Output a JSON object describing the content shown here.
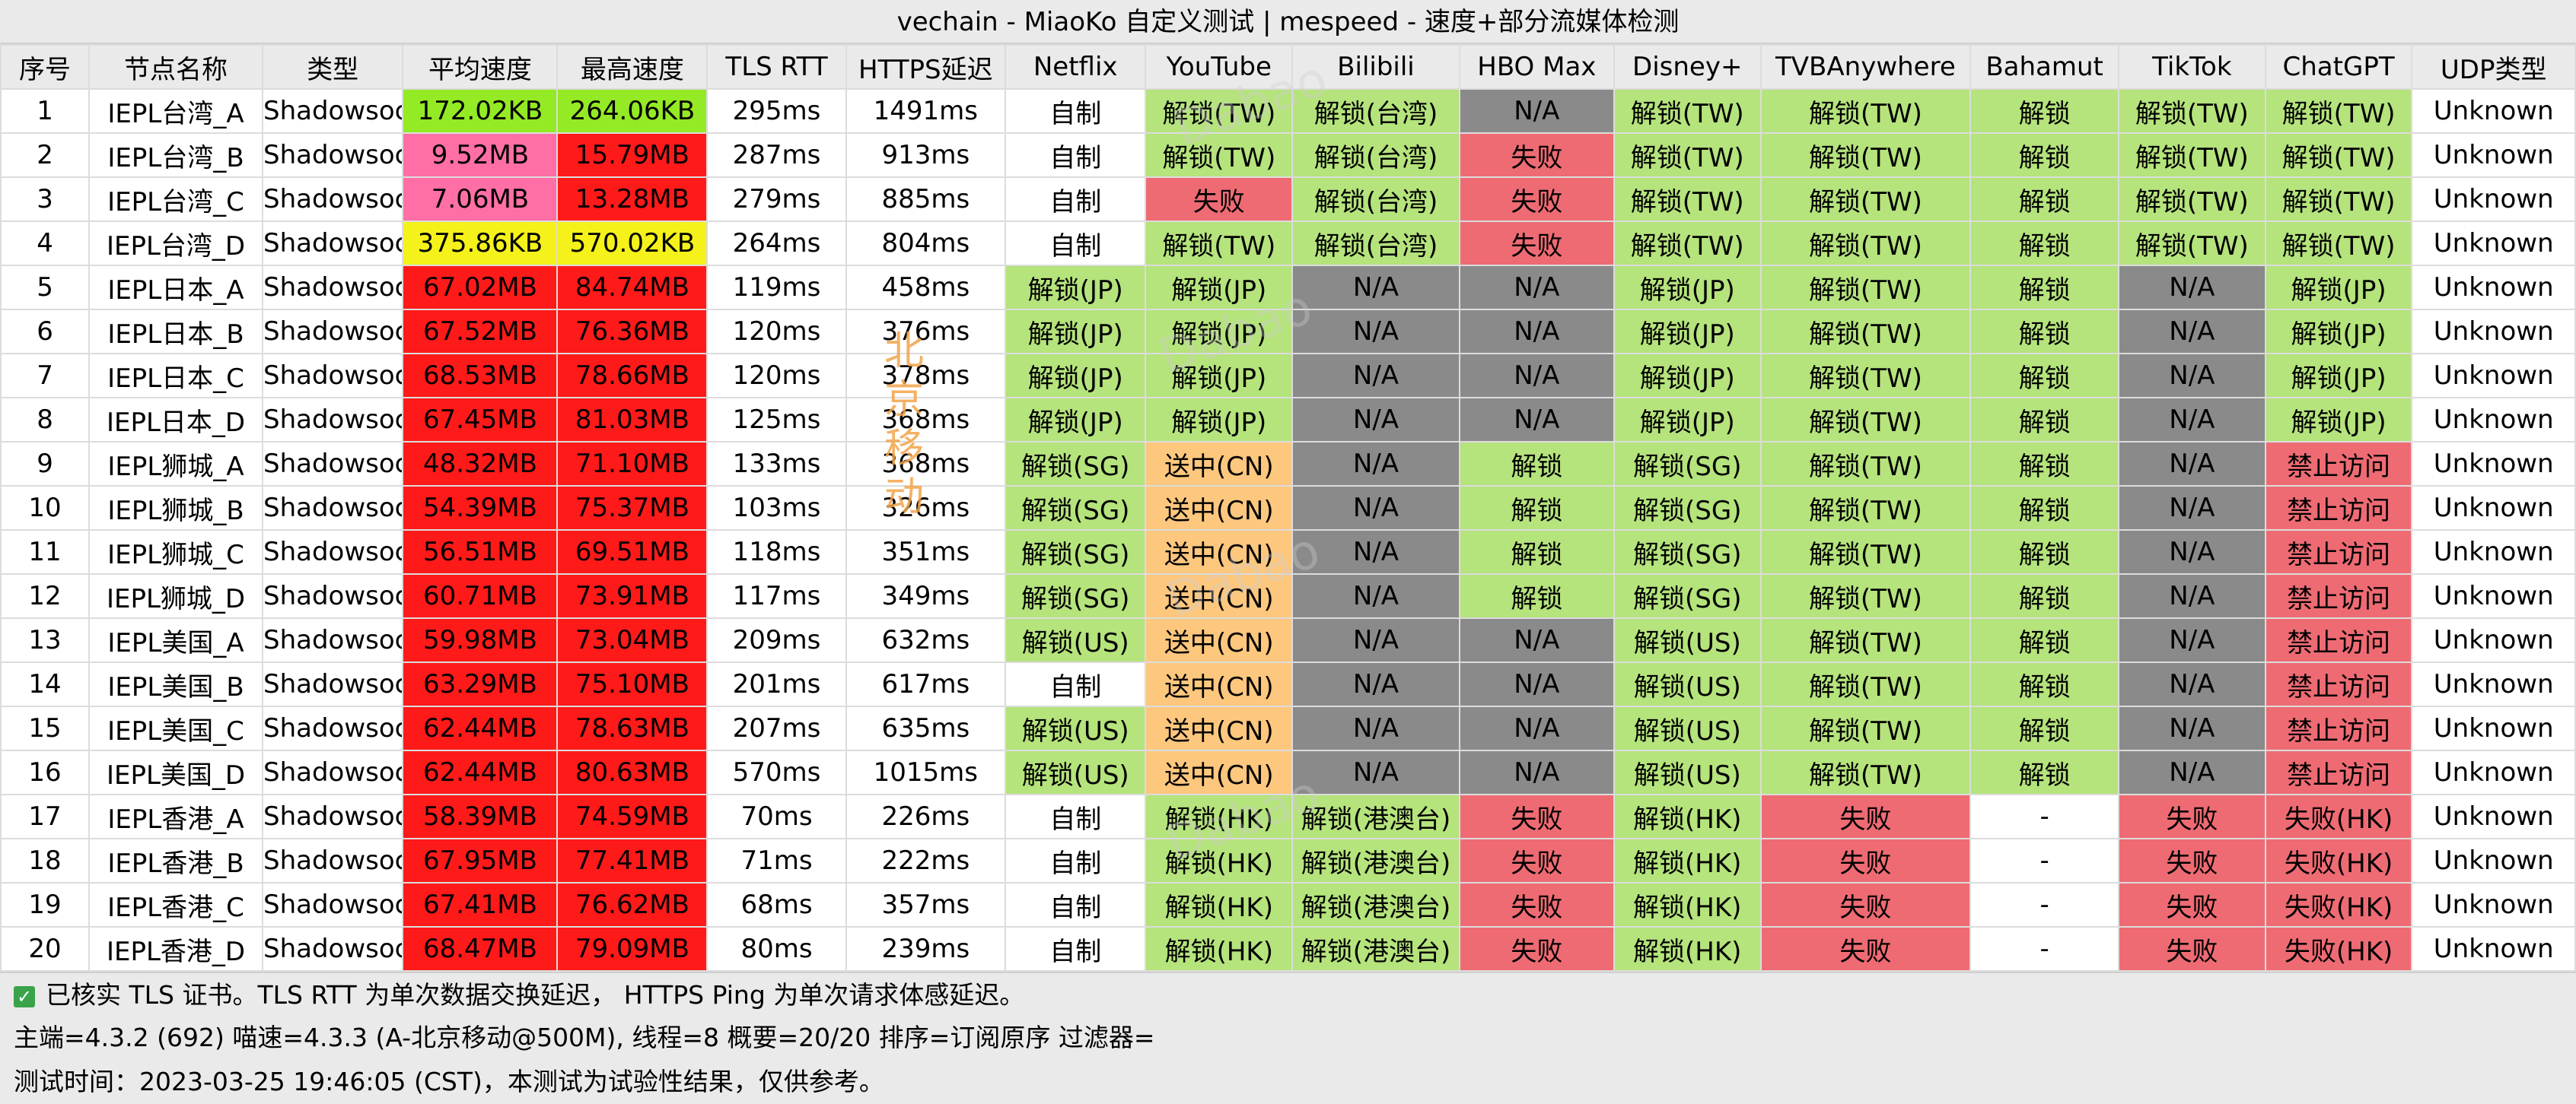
{
  "title": "vechain - MiaoKo 自定义测试 | mespeed - 速度+部分流媒体检测",
  "watermark_text": "北京移动",
  "watermark_faint": "Dabao",
  "columns": [
    "序号",
    "节点名称",
    "类型",
    "平均速度",
    "最高速度",
    "TLS RTT",
    "HTTPS延迟",
    "Netflix",
    "YouTube",
    "Bilibili",
    "HBO Max",
    "Disney+",
    "TVBAnywhere",
    "Bahamut",
    "TikTok",
    "ChatGPT",
    "UDP类型"
  ],
  "colors": {
    "green": "#b5e37c",
    "gray": "#8a8a8a",
    "red_fail": "#ee6b73",
    "orange": "#fdc77e",
    "white": "#ffffff",
    "speed_lime": "#94ea24",
    "speed_yellow": "#f4f21a",
    "speed_pink": "#ff6fa5",
    "speed_red": "#ff1a1a"
  },
  "rows": [
    [
      "1",
      "IEPL台湾_A",
      "ShadowsocksR",
      "172.02KB",
      "264.06KB",
      "295ms",
      "1491ms",
      "自制",
      "解锁(TW)",
      "解锁(台湾)",
      "N/A",
      "解锁(TW)",
      "解锁(TW)",
      "解锁",
      "解锁(TW)",
      "解锁(TW)",
      "Unknown"
    ],
    [
      "2",
      "IEPL台湾_B",
      "ShadowsocksR",
      "9.52MB",
      "15.79MB",
      "287ms",
      "913ms",
      "自制",
      "解锁(TW)",
      "解锁(台湾)",
      "失败",
      "解锁(TW)",
      "解锁(TW)",
      "解锁",
      "解锁(TW)",
      "解锁(TW)",
      "Unknown"
    ],
    [
      "3",
      "IEPL台湾_C",
      "ShadowsocksR",
      "7.06MB",
      "13.28MB",
      "279ms",
      "885ms",
      "自制",
      "失败",
      "解锁(台湾)",
      "失败",
      "解锁(TW)",
      "解锁(TW)",
      "解锁",
      "解锁(TW)",
      "解锁(TW)",
      "Unknown"
    ],
    [
      "4",
      "IEPL台湾_D",
      "ShadowsocksR",
      "375.86KB",
      "570.02KB",
      "264ms",
      "804ms",
      "自制",
      "解锁(TW)",
      "解锁(台湾)",
      "失败",
      "解锁(TW)",
      "解锁(TW)",
      "解锁",
      "解锁(TW)",
      "解锁(TW)",
      "Unknown"
    ],
    [
      "5",
      "IEPL日本_A",
      "ShadowsocksR",
      "67.02MB",
      "84.74MB",
      "119ms",
      "458ms",
      "解锁(JP)",
      "解锁(JP)",
      "N/A",
      "N/A",
      "解锁(JP)",
      "解锁(TW)",
      "解锁",
      "N/A",
      "解锁(JP)",
      "Unknown"
    ],
    [
      "6",
      "IEPL日本_B",
      "ShadowsocksR",
      "67.52MB",
      "76.36MB",
      "120ms",
      "376ms",
      "解锁(JP)",
      "解锁(JP)",
      "N/A",
      "N/A",
      "解锁(JP)",
      "解锁(TW)",
      "解锁",
      "N/A",
      "解锁(JP)",
      "Unknown"
    ],
    [
      "7",
      "IEPL日本_C",
      "ShadowsocksR",
      "68.53MB",
      "78.66MB",
      "120ms",
      "378ms",
      "解锁(JP)",
      "解锁(JP)",
      "N/A",
      "N/A",
      "解锁(JP)",
      "解锁(TW)",
      "解锁",
      "N/A",
      "解锁(JP)",
      "Unknown"
    ],
    [
      "8",
      "IEPL日本_D",
      "ShadowsocksR",
      "67.45MB",
      "81.03MB",
      "125ms",
      "368ms",
      "解锁(JP)",
      "解锁(JP)",
      "N/A",
      "N/A",
      "解锁(JP)",
      "解锁(TW)",
      "解锁",
      "N/A",
      "解锁(JP)",
      "Unknown"
    ],
    [
      "9",
      "IEPL狮城_A",
      "ShadowsocksR",
      "48.32MB",
      "71.10MB",
      "133ms",
      "368ms",
      "解锁(SG)",
      "送中(CN)",
      "N/A",
      "解锁",
      "解锁(SG)",
      "解锁(TW)",
      "解锁",
      "N/A",
      "禁止访问",
      "Unknown"
    ],
    [
      "10",
      "IEPL狮城_B",
      "ShadowsocksR",
      "54.39MB",
      "75.37MB",
      "103ms",
      "326ms",
      "解锁(SG)",
      "送中(CN)",
      "N/A",
      "解锁",
      "解锁(SG)",
      "解锁(TW)",
      "解锁",
      "N/A",
      "禁止访问",
      "Unknown"
    ],
    [
      "11",
      "IEPL狮城_C",
      "ShadowsocksR",
      "56.51MB",
      "69.51MB",
      "118ms",
      "351ms",
      "解锁(SG)",
      "送中(CN)",
      "N/A",
      "解锁",
      "解锁(SG)",
      "解锁(TW)",
      "解锁",
      "N/A",
      "禁止访问",
      "Unknown"
    ],
    [
      "12",
      "IEPL狮城_D",
      "ShadowsocksR",
      "60.71MB",
      "73.91MB",
      "117ms",
      "349ms",
      "解锁(SG)",
      "送中(CN)",
      "N/A",
      "解锁",
      "解锁(SG)",
      "解锁(TW)",
      "解锁",
      "N/A",
      "禁止访问",
      "Unknown"
    ],
    [
      "13",
      "IEPL美国_A",
      "ShadowsocksR",
      "59.98MB",
      "73.04MB",
      "209ms",
      "632ms",
      "解锁(US)",
      "送中(CN)",
      "N/A",
      "N/A",
      "解锁(US)",
      "解锁(TW)",
      "解锁",
      "N/A",
      "禁止访问",
      "Unknown"
    ],
    [
      "14",
      "IEPL美国_B",
      "ShadowsocksR",
      "63.29MB",
      "75.10MB",
      "201ms",
      "617ms",
      "自制",
      "送中(CN)",
      "N/A",
      "N/A",
      "解锁(US)",
      "解锁(TW)",
      "解锁",
      "N/A",
      "禁止访问",
      "Unknown"
    ],
    [
      "15",
      "IEPL美国_C",
      "ShadowsocksR",
      "62.44MB",
      "78.63MB",
      "207ms",
      "635ms",
      "解锁(US)",
      "送中(CN)",
      "N/A",
      "N/A",
      "解锁(US)",
      "解锁(TW)",
      "解锁",
      "N/A",
      "禁止访问",
      "Unknown"
    ],
    [
      "16",
      "IEPL美国_D",
      "ShadowsocksR",
      "62.44MB",
      "80.63MB",
      "570ms",
      "1015ms",
      "解锁(US)",
      "送中(CN)",
      "N/A",
      "N/A",
      "解锁(US)",
      "解锁(TW)",
      "解锁",
      "N/A",
      "禁止访问",
      "Unknown"
    ],
    [
      "17",
      "IEPL香港_A",
      "ShadowsocksR",
      "58.39MB",
      "74.59MB",
      "70ms",
      "226ms",
      "自制",
      "解锁(HK)",
      "解锁(港澳台)",
      "失败",
      "解锁(HK)",
      "失败",
      "-",
      "失败",
      "失败(HK)",
      "Unknown"
    ],
    [
      "18",
      "IEPL香港_B",
      "ShadowsocksR",
      "67.95MB",
      "77.41MB",
      "71ms",
      "222ms",
      "自制",
      "解锁(HK)",
      "解锁(港澳台)",
      "失败",
      "解锁(HK)",
      "失败",
      "-",
      "失败",
      "失败(HK)",
      "Unknown"
    ],
    [
      "19",
      "IEPL香港_C",
      "ShadowsocksR",
      "67.41MB",
      "76.62MB",
      "68ms",
      "357ms",
      "自制",
      "解锁(HK)",
      "解锁(港澳台)",
      "失败",
      "解锁(HK)",
      "失败",
      "-",
      "失败",
      "失败(HK)",
      "Unknown"
    ],
    [
      "20",
      "IEPL香港_D",
      "ShadowsocksR",
      "68.47MB",
      "79.09MB",
      "80ms",
      "239ms",
      "自制",
      "解锁(HK)",
      "解锁(港澳台)",
      "失败",
      "解锁(HK)",
      "失败",
      "-",
      "失败",
      "失败(HK)",
      "Unknown"
    ]
  ],
  "speed_colors": [
    [
      "speed_lime",
      "speed_lime"
    ],
    [
      "speed_pink",
      "speed_red"
    ],
    [
      "speed_pink",
      "speed_red"
    ],
    [
      "speed_yellow",
      "speed_yellow"
    ],
    [
      "speed_red",
      "speed_red"
    ],
    [
      "speed_red",
      "speed_red"
    ],
    [
      "speed_red",
      "speed_red"
    ],
    [
      "speed_red",
      "speed_red"
    ],
    [
      "speed_red",
      "speed_red"
    ],
    [
      "speed_red",
      "speed_red"
    ],
    [
      "speed_red",
      "speed_red"
    ],
    [
      "speed_red",
      "speed_red"
    ],
    [
      "speed_red",
      "speed_red"
    ],
    [
      "speed_red",
      "speed_red"
    ],
    [
      "speed_red",
      "speed_red"
    ],
    [
      "speed_red",
      "speed_red"
    ],
    [
      "speed_red",
      "speed_red"
    ],
    [
      "speed_red",
      "speed_red"
    ],
    [
      "speed_red",
      "speed_red"
    ],
    [
      "speed_red",
      "speed_red"
    ]
  ],
  "footer": {
    "line1": "已核实 TLS 证书。TLS RTT 为单次数据交换延迟， HTTPS Ping 为单次请求体感延迟。",
    "line2": "主端=4.3.2 (692) 喵速=4.3.3 (A-北京移动@500M), 线程=8 概要=20/20 排序=订阅原序 过滤器=",
    "line3": "测试时间：2023-03-25 19:46:05 (CST)，本测试为试验性结果，仅供参考。"
  }
}
